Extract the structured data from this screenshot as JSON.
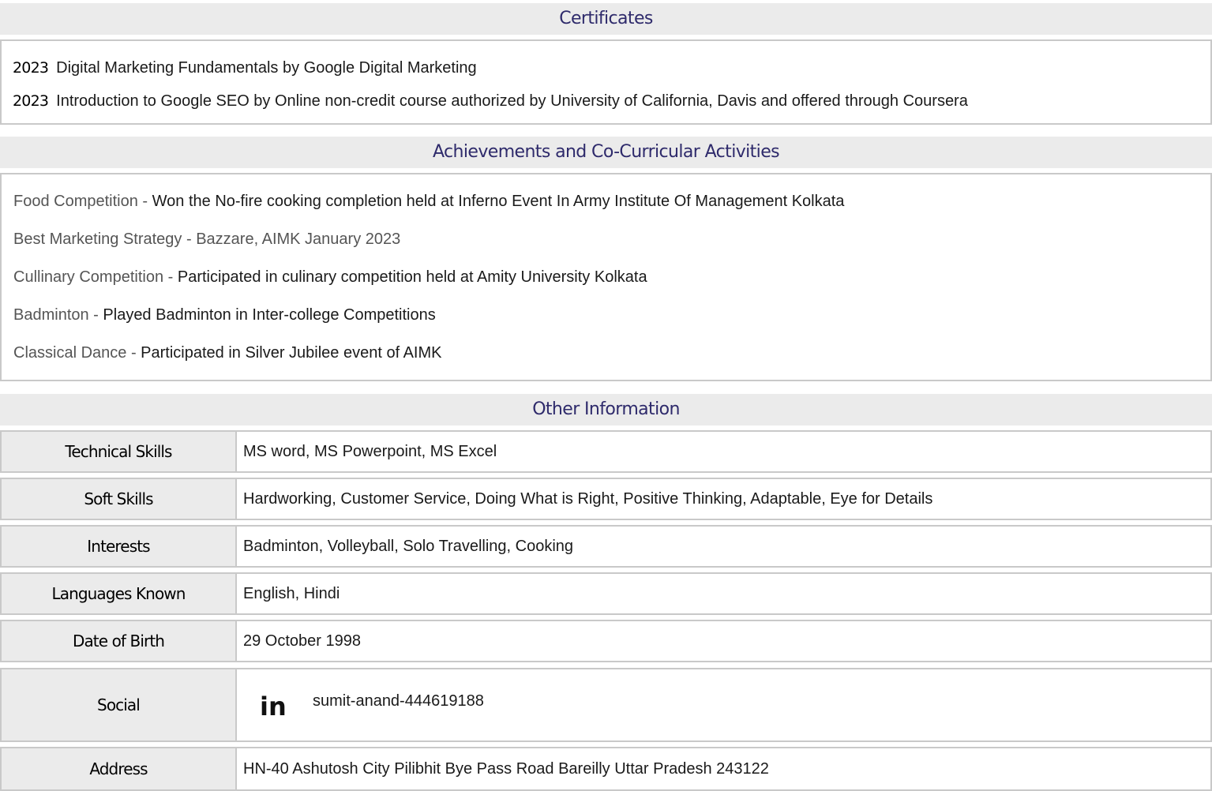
{
  "certificates": {
    "heading": "Certificates",
    "items": [
      {
        "year": "2023",
        "text": "Digital Marketing Fundamentals by Google Digital Marketing"
      },
      {
        "year": "2023",
        "text": "Introduction to Google SEO by Online non-credit course authorized by University of California, Davis and offered through Coursera"
      }
    ]
  },
  "achievements": {
    "heading": "Achievements and Co-Curricular Activities",
    "separator": " - ",
    "items": [
      {
        "title": "Food Competition",
        "desc": "Won the No-fire cooking completion held at Inferno Event In Army Institute Of Management Kolkata"
      },
      {
        "title": "Best Marketing Strategy",
        "desc": "Bazzare, AIMK January 2023"
      },
      {
        "title": "Cullinary Competition",
        "desc": "Participated in culinary competition held at Amity University Kolkata"
      },
      {
        "title": "Badminton",
        "desc": "Played Badminton in Inter-college Competitions"
      },
      {
        "title": "Classical Dance",
        "desc": "Participated in Silver Jubilee event of AIMK"
      }
    ]
  },
  "other_info": {
    "heading": "Other Information",
    "rows": [
      {
        "label": "Technical Skills",
        "value": "MS word, MS Powerpoint, MS Excel"
      },
      {
        "label": "Soft Skills",
        "value": "Hardworking, Customer Service, Doing What is Right, Positive Thinking, Adaptable, Eye for Details"
      },
      {
        "label": "Interests",
        "value": "Badminton, Volleyball, Solo Travelling, Cooking"
      },
      {
        "label": "Languages Known",
        "value": "English, Hindi"
      },
      {
        "label": "Date of Birth",
        "value": "29 October 1998"
      },
      {
        "label": "Social",
        "icon": "linkedin-icon",
        "icon_text": "in",
        "value": "sumit-anand-444619188"
      },
      {
        "label": "Address",
        "value": "HN-40 Ashutosh City Pilibhit Bye Pass Road Bareilly Uttar Pradesh 243122"
      }
    ]
  }
}
